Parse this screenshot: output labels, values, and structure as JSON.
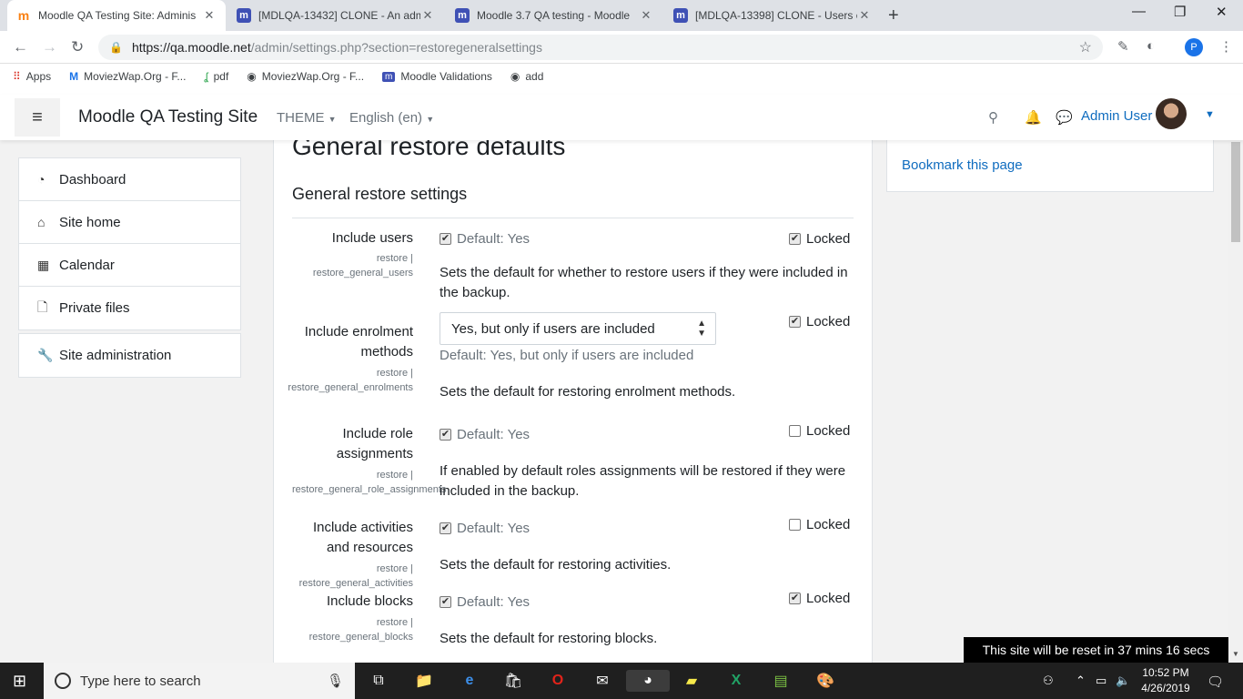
{
  "browser": {
    "tabs": [
      {
        "title": "Moodle QA Testing Site: Adminis",
        "icon": "moodle-icon"
      },
      {
        "title": "[MDLQA-13432] CLONE - An adm",
        "icon": "jira-icon"
      },
      {
        "title": "Moodle 3.7 QA testing - Moodle",
        "icon": "jira-icon"
      },
      {
        "title": "[MDLQA-13398] CLONE - Users c",
        "icon": "jira-icon"
      }
    ],
    "url_host": "https://qa.moodle.net",
    "url_path": "/admin/settings.php?section=restoregeneralsettings",
    "profile_initial": "P",
    "bookmarks": [
      {
        "label": "Apps",
        "icon": "apps-grid-icon"
      },
      {
        "label": "MoviezWap.Org - F...",
        "icon": "moviezwap-icon"
      },
      {
        "label": "pdf",
        "icon": "pdf-icon"
      },
      {
        "label": "MoviezWap.Org - F...",
        "icon": "globe-icon"
      },
      {
        "label": "Moodle Validations",
        "icon": "jira-icon"
      },
      {
        "label": "add",
        "icon": "globe-icon"
      }
    ]
  },
  "header": {
    "site_name": "Moodle QA Testing Site",
    "theme_menu": "THEME",
    "language_menu": "English (en)",
    "user_name": "Admin User"
  },
  "nav": {
    "block1": [
      {
        "label": "Dashboard",
        "icon": "dashboard-icon"
      },
      {
        "label": "Site home",
        "icon": "home-icon"
      },
      {
        "label": "Calendar",
        "icon": "calendar-icon"
      },
      {
        "label": "Private files",
        "icon": "file-icon"
      }
    ],
    "block2": [
      {
        "label": "Site administration",
        "icon": "wrench-icon"
      }
    ]
  },
  "main": {
    "heading": "General restore defaults",
    "section": "General restore settings",
    "locked_label": "Locked",
    "settings": [
      {
        "label1": "Include users",
        "label2": "",
        "tag1": "restore |",
        "tag2": "restore_general_users",
        "default": "Default: Yes",
        "checked": true,
        "locked": true,
        "desc1": "Sets the default for whether to restore users if they were included in",
        "desc2": "the backup."
      },
      {
        "label1": "Include enrolment",
        "label2": "methods",
        "tag1": "restore |",
        "tag2": "restore_general_enrolments",
        "select": "Yes, but only if users are included",
        "default": "Default: Yes, but only if users are included",
        "locked": true,
        "desc1": "Sets the default for restoring enrolment methods.",
        "desc2": ""
      },
      {
        "label1": "Include role",
        "label2": "assignments",
        "tag1": "restore |",
        "tag2": "restore_general_role_assignments",
        "default": "Default: Yes",
        "checked": true,
        "locked": false,
        "desc1": "If enabled by default roles assignments will be restored if they were",
        "desc2": "included in the backup."
      },
      {
        "label1": "Include activities",
        "label2": "and resources",
        "tag1": "restore |",
        "tag2": "restore_general_activities",
        "default": "Default: Yes",
        "checked": true,
        "locked": false,
        "desc1": "Sets the default for restoring activities.",
        "desc2": ""
      },
      {
        "label1": "Include blocks",
        "label2": "",
        "tag1": "restore |",
        "tag2": "restore_general_blocks",
        "default": "Default: Yes",
        "checked": true,
        "locked": true,
        "desc1": "Sets the default for restoring blocks.",
        "desc2": ""
      }
    ]
  },
  "right": {
    "bookmark": "Bookmark this page"
  },
  "reset_notice": "This site will be reset in 37 mins 16 secs",
  "taskbar": {
    "search_placeholder": "Type here to search",
    "time": "10:52 PM",
    "date": "4/26/2019"
  }
}
